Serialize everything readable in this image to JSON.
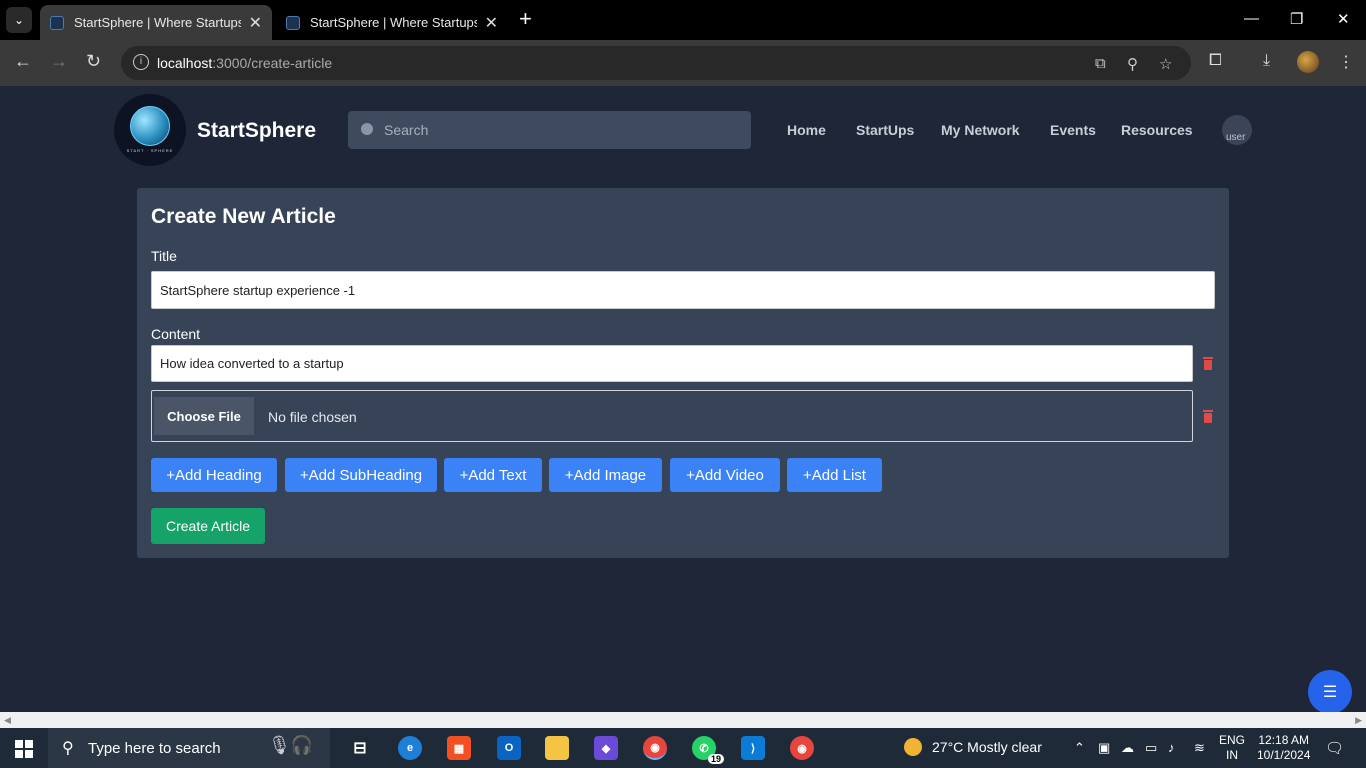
{
  "browser": {
    "tabs": [
      {
        "title": "StartSphere | Where Startups Ta",
        "active": true
      },
      {
        "title": "StartSphere | Where Startups Ta",
        "active": false
      }
    ],
    "url_host": "localhost",
    "url_path": ":3000/create-article"
  },
  "header": {
    "brand": "StartSphere",
    "logo_text": "START · SPHERE",
    "search_placeholder": "Search",
    "nav": [
      "Home",
      "StartUps",
      "My Network",
      "Events",
      "Resources"
    ],
    "avatar_alt": "user"
  },
  "form": {
    "heading": "Create New Article",
    "title_label": "Title",
    "title_value": "StartSphere startup experience -1",
    "content_label": "Content",
    "content_value": "How idea converted to a startup",
    "choose_file": "Choose File",
    "no_file": "No file chosen",
    "add_buttons": [
      "+Add Heading",
      "+Add SubHeading",
      "+Add Text",
      "+Add Image",
      "+Add Video",
      "+Add List"
    ],
    "create_label": "Create Article"
  },
  "taskbar": {
    "search_placeholder": "Type here to search",
    "whatsapp_badge": "19",
    "weather": "27°C  Mostly clear",
    "lang_1": "ENG",
    "lang_2": "IN",
    "time": "12:18 AM",
    "date": "10/1/2024"
  },
  "colors": {
    "page_bg": "#1e2638",
    "card_bg": "#374357",
    "add_button": "#3b82f6",
    "create_button": "#16a36a",
    "delete_icon": "#e24a4a"
  }
}
